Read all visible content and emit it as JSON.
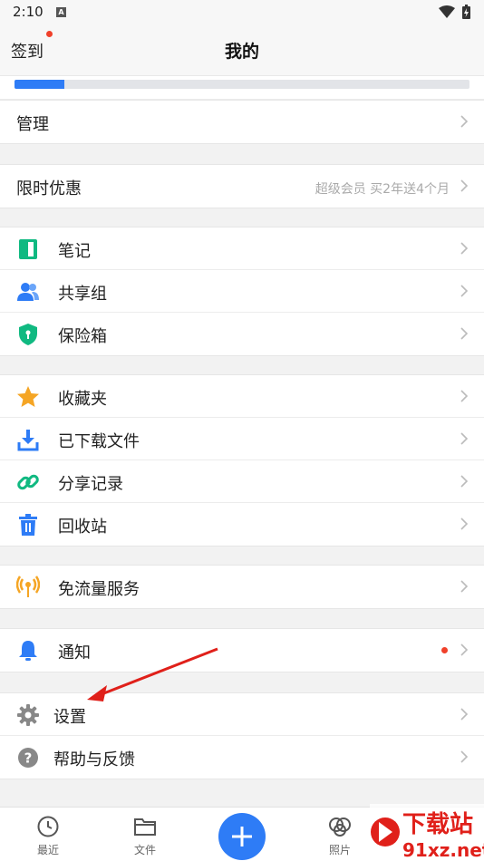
{
  "status_bar": {
    "time": "2:10",
    "notif_icon": "a-icon"
  },
  "header": {
    "checkin_label": "签到",
    "title": "我的"
  },
  "storage": {
    "used_fraction": 0.11
  },
  "sections": {
    "manage": {
      "label": "管理"
    },
    "promo": {
      "label": "限时优惠",
      "hint": "超级会员 买2年送4个月"
    },
    "tools": [
      {
        "label": "笔记",
        "icon": "note-icon",
        "color": "#10b981"
      },
      {
        "label": "共享组",
        "icon": "group-icon",
        "color": "#2e7cf6"
      },
      {
        "label": "保险箱",
        "icon": "shield-icon",
        "color": "#10b981"
      }
    ],
    "files": [
      {
        "label": "收藏夹",
        "icon": "star-icon",
        "color": "#f5a524"
      },
      {
        "label": "已下载文件",
        "icon": "download-icon",
        "color": "#2e7cf6"
      },
      {
        "label": "分享记录",
        "icon": "link-icon",
        "color": "#10b981"
      },
      {
        "label": "回收站",
        "icon": "trash-icon",
        "color": "#2e7cf6"
      }
    ],
    "traffic": {
      "label": "免流量服务",
      "icon": "signal-icon",
      "color": "#f5a524"
    },
    "notify": {
      "label": "通知",
      "icon": "bell-icon",
      "color": "#2e7cf6"
    },
    "settings": [
      {
        "label": "设置",
        "icon": "gear-icon",
        "color": "#888888"
      },
      {
        "label": "帮助与反馈",
        "icon": "help-icon",
        "color": "#888888"
      }
    ]
  },
  "tabbar": {
    "recent": "最近",
    "files": "文件",
    "photos": "照片"
  },
  "colors": {
    "accent": "#2e7cf6",
    "red_dot": "#f0402a",
    "annotation_arrow": "#e0201a"
  }
}
